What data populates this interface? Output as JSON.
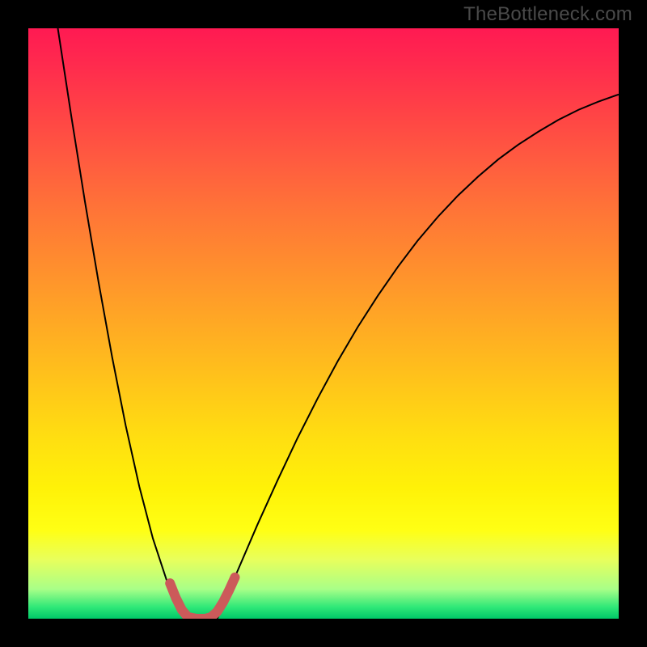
{
  "watermark": "TheBottleneck.com",
  "chart_data": {
    "type": "line",
    "title": "",
    "xlabel": "",
    "ylabel": "",
    "xlim": [
      0,
      100
    ],
    "ylim": [
      0,
      100
    ],
    "grid": false,
    "legend": false,
    "gradient_stops": [
      {
        "pos": 0,
        "color": "#ff1a52"
      },
      {
        "pos": 25,
        "color": "#ff6a3c"
      },
      {
        "pos": 50,
        "color": "#ffb820"
      },
      {
        "pos": 75,
        "color": "#fff010"
      },
      {
        "pos": 90,
        "color": "#d8ff58"
      },
      {
        "pos": 100,
        "color": "#00c868"
      }
    ],
    "series": [
      {
        "name": "left-branch",
        "stroke": "#000000",
        "width": 2,
        "x": [
          5.0,
          7.3,
          9.6,
          11.9,
          14.2,
          16.5,
          18.8,
          21.1,
          23.4,
          25.7,
          27.0
        ],
        "y": [
          100.0,
          85.0,
          70.6,
          57.0,
          44.3,
          32.7,
          22.4,
          13.6,
          6.6,
          1.6,
          0.0
        ]
      },
      {
        "name": "right-branch",
        "stroke": "#000000",
        "width": 2,
        "x": [
          32.0,
          35.4,
          38.8,
          42.2,
          45.6,
          49.0,
          52.4,
          55.8,
          59.2,
          62.6,
          66.0,
          69.4,
          72.8,
          76.2,
          79.6,
          83.0,
          86.4,
          89.8,
          93.2,
          96.6,
          100.0
        ],
        "y": [
          0.0,
          8.0,
          15.9,
          23.4,
          30.6,
          37.3,
          43.6,
          49.4,
          54.7,
          59.6,
          64.1,
          68.1,
          71.7,
          74.9,
          77.8,
          80.3,
          82.5,
          84.5,
          86.2,
          87.6,
          88.8
        ]
      },
      {
        "name": "valley-marker",
        "stroke": "#cc5a5a",
        "width": 12,
        "linecap": "round",
        "x": [
          24.0,
          25.0,
          26.0,
          27.0,
          28.5,
          30.0,
          31.0,
          32.0,
          33.0,
          34.0,
          35.0
        ],
        "y": [
          6.0,
          3.5,
          1.5,
          0.3,
          0.0,
          0.0,
          0.3,
          1.2,
          2.8,
          4.8,
          7.0
        ]
      }
    ]
  }
}
